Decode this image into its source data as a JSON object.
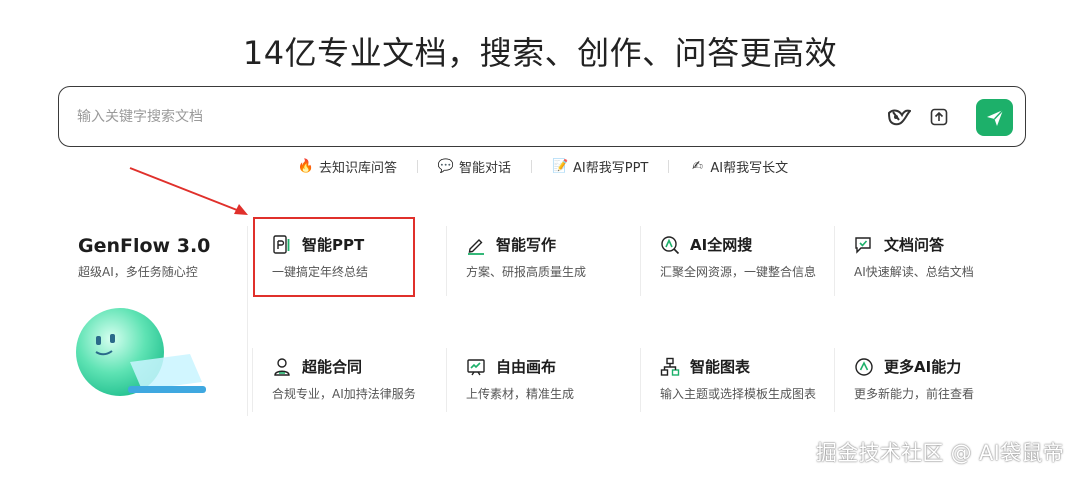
{
  "hero": {
    "title": "14亿专业文档，搜索、创作、问答更高效"
  },
  "search": {
    "placeholder": "输入关键字搜索文档",
    "value": "",
    "icons": {
      "deep_search": "deep-search-bird-icon",
      "upload": "upload-icon",
      "send": "send-paper-plane-icon"
    },
    "send_color": "#1db06a"
  },
  "quick_links": [
    {
      "emoji": "🔥",
      "icon": "fire-icon",
      "label": "去知识库问答"
    },
    {
      "emoji": "💬",
      "icon": "chat-bubble-icon",
      "label": "智能对话"
    },
    {
      "emoji": "📝",
      "icon": "memo-icon",
      "label": "AI帮我写PPT"
    },
    {
      "emoji": "✍",
      "icon": "writing-hand-icon",
      "label": "AI帮我写长文"
    }
  ],
  "genflow": {
    "title": "GenFlow 3.0",
    "subtitle": "超级AI，多任务随心控",
    "mascot": "ai-mascot-laptop-icon"
  },
  "cards": [
    {
      "title": "智能PPT",
      "subtitle": "一键搞定年终总结",
      "icon": "ppt-icon"
    },
    {
      "title": "智能写作",
      "subtitle": "方案、研报高质量生成",
      "icon": "pen-writing-icon"
    },
    {
      "title": "AI全网搜",
      "subtitle": "汇聚全网资源，一键整合信息",
      "icon": "web-search-icon"
    },
    {
      "title": "文档问答",
      "subtitle": "AI快速解读、总结文档",
      "icon": "doc-chat-icon"
    },
    {
      "title": "超能合同",
      "subtitle": "合规专业，AI加持法律服务",
      "icon": "contract-person-icon"
    },
    {
      "title": "自由画布",
      "subtitle": "上传素材，精准生成",
      "icon": "canvas-board-icon"
    },
    {
      "title": "智能图表",
      "subtitle": "输入主题或选择模板生成图表",
      "icon": "flowchart-icon"
    },
    {
      "title": "更多AI能力",
      "subtitle": "更多新能力，前往查看",
      "icon": "more-ai-icon"
    }
  ],
  "annotation": {
    "highlight_color": "#e0302b",
    "arrow_color": "#e0302b"
  },
  "watermark": "掘金技术社区 @ AI袋鼠帝"
}
